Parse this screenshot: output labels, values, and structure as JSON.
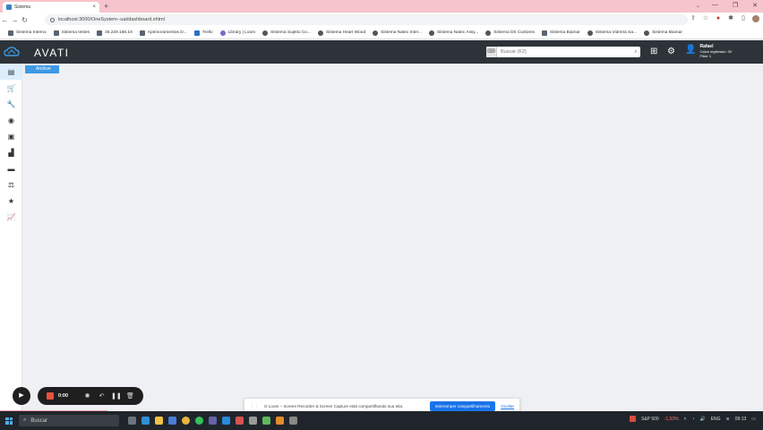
{
  "browser": {
    "tab_title": "Sistema",
    "url": "localhost:3000/OneSystem--uai/dashboard.xhtml"
  },
  "bookmarks": [
    {
      "label": "Sistema Interno",
      "icon": "folder"
    },
    {
      "label": "Sistema testes",
      "icon": "folder"
    },
    {
      "label": "45.229.168.18",
      "icon": "folder"
    },
    {
      "label": "Aprimoramentos D...",
      "icon": "folder"
    },
    {
      "label": "Trello",
      "icon": "blue"
    },
    {
      "label": "Library | Loom",
      "icon": "purple"
    },
    {
      "label": "Sistema Sujeito Co...",
      "icon": "g"
    },
    {
      "label": "Sistema Heart Wood",
      "icon": "g"
    },
    {
      "label": "Sistema Natec Inter...",
      "icon": "g"
    },
    {
      "label": "Sistema Natec Assy...",
      "icon": "g"
    },
    {
      "label": "Sistema DS Customs",
      "icon": "g"
    },
    {
      "label": "Sistema Biamar",
      "icon": "folder"
    },
    {
      "label": "Sistema Vidreira Sa...",
      "icon": "g"
    },
    {
      "label": "Sistema Biamar",
      "icon": "g"
    }
  ],
  "app": {
    "brand": "AVATI",
    "search_placeholder": "Buscar (F2)",
    "user": {
      "name": "Rafael",
      "line1": "Caixa registrado: 00",
      "line2": "Filial: 1"
    },
    "sidebar_tooltip": "Archive"
  },
  "sidebar_icons": [
    "archive-icon",
    "cart-icon",
    "wrench-icon",
    "coins-icon",
    "cash-icon",
    "factory-icon",
    "truck-icon",
    "scale-icon",
    "star-icon",
    "chart-icon"
  ],
  "loom": {
    "time": "0:00"
  },
  "share_notice": {
    "message": "O Loom – Screen Recorder & Screen Capture está compartilhando sua tela.",
    "stop_label": "Interromper compartilhamento",
    "hide_label": "Ocultar"
  },
  "taskbar": {
    "search_label": "Buscar",
    "stock_label": "S&P 500",
    "stock_change": "-1,53%",
    "language": "ENG",
    "time": "09:13"
  },
  "colors": {
    "appbar": "#2d3338",
    "accent": "#3d99e6",
    "tabstrip": "#f6c4cc"
  }
}
